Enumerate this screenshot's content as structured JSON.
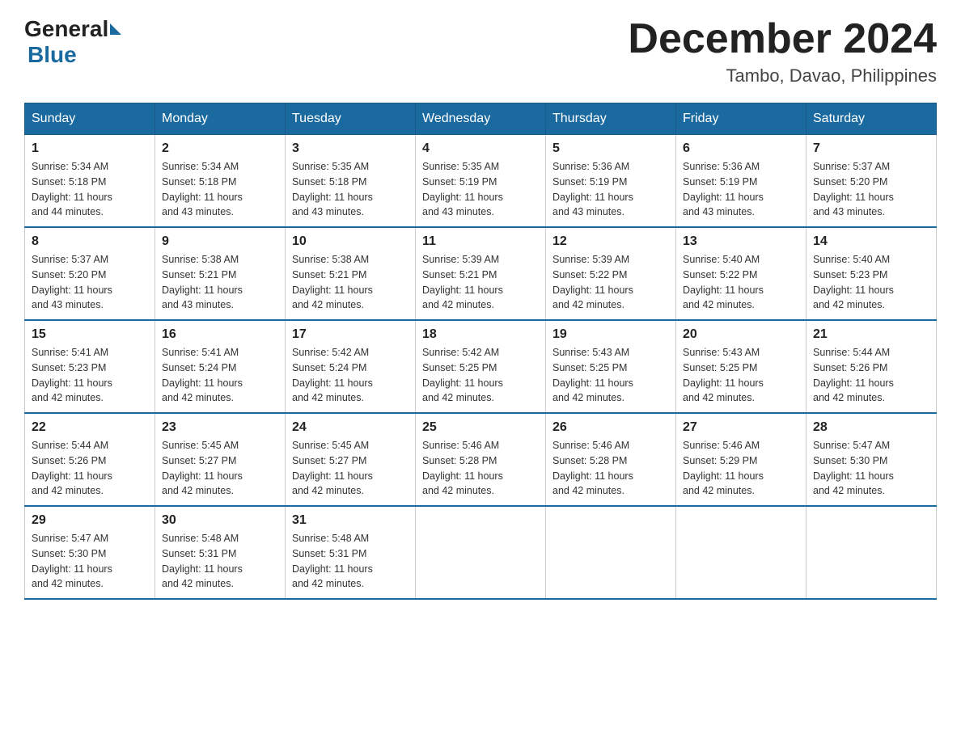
{
  "header": {
    "logo_general": "General",
    "logo_blue": "Blue",
    "month_title": "December 2024",
    "location": "Tambo, Davao, Philippines"
  },
  "weekdays": [
    "Sunday",
    "Monday",
    "Tuesday",
    "Wednesday",
    "Thursday",
    "Friday",
    "Saturday"
  ],
  "weeks": [
    [
      {
        "day": "1",
        "sunrise": "5:34 AM",
        "sunset": "5:18 PM",
        "daylight": "11 hours and 44 minutes."
      },
      {
        "day": "2",
        "sunrise": "5:34 AM",
        "sunset": "5:18 PM",
        "daylight": "11 hours and 43 minutes."
      },
      {
        "day": "3",
        "sunrise": "5:35 AM",
        "sunset": "5:18 PM",
        "daylight": "11 hours and 43 minutes."
      },
      {
        "day": "4",
        "sunrise": "5:35 AM",
        "sunset": "5:19 PM",
        "daylight": "11 hours and 43 minutes."
      },
      {
        "day": "5",
        "sunrise": "5:36 AM",
        "sunset": "5:19 PM",
        "daylight": "11 hours and 43 minutes."
      },
      {
        "day": "6",
        "sunrise": "5:36 AM",
        "sunset": "5:19 PM",
        "daylight": "11 hours and 43 minutes."
      },
      {
        "day": "7",
        "sunrise": "5:37 AM",
        "sunset": "5:20 PM",
        "daylight": "11 hours and 43 minutes."
      }
    ],
    [
      {
        "day": "8",
        "sunrise": "5:37 AM",
        "sunset": "5:20 PM",
        "daylight": "11 hours and 43 minutes."
      },
      {
        "day": "9",
        "sunrise": "5:38 AM",
        "sunset": "5:21 PM",
        "daylight": "11 hours and 43 minutes."
      },
      {
        "day": "10",
        "sunrise": "5:38 AM",
        "sunset": "5:21 PM",
        "daylight": "11 hours and 42 minutes."
      },
      {
        "day": "11",
        "sunrise": "5:39 AM",
        "sunset": "5:21 PM",
        "daylight": "11 hours and 42 minutes."
      },
      {
        "day": "12",
        "sunrise": "5:39 AM",
        "sunset": "5:22 PM",
        "daylight": "11 hours and 42 minutes."
      },
      {
        "day": "13",
        "sunrise": "5:40 AM",
        "sunset": "5:22 PM",
        "daylight": "11 hours and 42 minutes."
      },
      {
        "day": "14",
        "sunrise": "5:40 AM",
        "sunset": "5:23 PM",
        "daylight": "11 hours and 42 minutes."
      }
    ],
    [
      {
        "day": "15",
        "sunrise": "5:41 AM",
        "sunset": "5:23 PM",
        "daylight": "11 hours and 42 minutes."
      },
      {
        "day": "16",
        "sunrise": "5:41 AM",
        "sunset": "5:24 PM",
        "daylight": "11 hours and 42 minutes."
      },
      {
        "day": "17",
        "sunrise": "5:42 AM",
        "sunset": "5:24 PM",
        "daylight": "11 hours and 42 minutes."
      },
      {
        "day": "18",
        "sunrise": "5:42 AM",
        "sunset": "5:25 PM",
        "daylight": "11 hours and 42 minutes."
      },
      {
        "day": "19",
        "sunrise": "5:43 AM",
        "sunset": "5:25 PM",
        "daylight": "11 hours and 42 minutes."
      },
      {
        "day": "20",
        "sunrise": "5:43 AM",
        "sunset": "5:25 PM",
        "daylight": "11 hours and 42 minutes."
      },
      {
        "day": "21",
        "sunrise": "5:44 AM",
        "sunset": "5:26 PM",
        "daylight": "11 hours and 42 minutes."
      }
    ],
    [
      {
        "day": "22",
        "sunrise": "5:44 AM",
        "sunset": "5:26 PM",
        "daylight": "11 hours and 42 minutes."
      },
      {
        "day": "23",
        "sunrise": "5:45 AM",
        "sunset": "5:27 PM",
        "daylight": "11 hours and 42 minutes."
      },
      {
        "day": "24",
        "sunrise": "5:45 AM",
        "sunset": "5:27 PM",
        "daylight": "11 hours and 42 minutes."
      },
      {
        "day": "25",
        "sunrise": "5:46 AM",
        "sunset": "5:28 PM",
        "daylight": "11 hours and 42 minutes."
      },
      {
        "day": "26",
        "sunrise": "5:46 AM",
        "sunset": "5:28 PM",
        "daylight": "11 hours and 42 minutes."
      },
      {
        "day": "27",
        "sunrise": "5:46 AM",
        "sunset": "5:29 PM",
        "daylight": "11 hours and 42 minutes."
      },
      {
        "day": "28",
        "sunrise": "5:47 AM",
        "sunset": "5:30 PM",
        "daylight": "11 hours and 42 minutes."
      }
    ],
    [
      {
        "day": "29",
        "sunrise": "5:47 AM",
        "sunset": "5:30 PM",
        "daylight": "11 hours and 42 minutes."
      },
      {
        "day": "30",
        "sunrise": "5:48 AM",
        "sunset": "5:31 PM",
        "daylight": "11 hours and 42 minutes."
      },
      {
        "day": "31",
        "sunrise": "5:48 AM",
        "sunset": "5:31 PM",
        "daylight": "11 hours and 42 minutes."
      },
      null,
      null,
      null,
      null
    ]
  ],
  "labels": {
    "sunrise": "Sunrise:",
    "sunset": "Sunset:",
    "daylight": "Daylight:"
  }
}
